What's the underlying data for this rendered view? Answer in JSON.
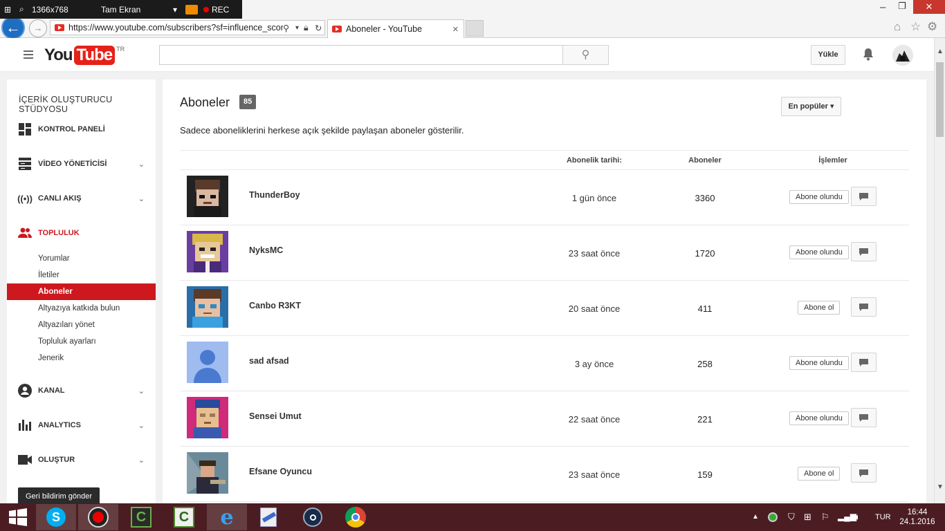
{
  "recorder": {
    "resolution": "1366x768",
    "mode": "Tam Ekran",
    "rec_label": "REC"
  },
  "browser": {
    "url": "https://www.youtube.com/subscribers?sf=influence_scor",
    "tab_title": "Aboneler - YouTube",
    "tab_close": "×"
  },
  "header": {
    "logo_you": "You",
    "logo_tube": "Tube",
    "logo_region": "TR",
    "search_placeholder": "",
    "upload_label": "Yükle"
  },
  "sidebar": {
    "studio_title": "İÇERİK OLUŞTURUCU STÜDYOSU",
    "sections": [
      {
        "label": "KONTROL PANELİ",
        "icon": "dashboard-icon",
        "expandable": false
      },
      {
        "label": "VİDEO YÖNETİCİSİ",
        "icon": "video-manager-icon",
        "expandable": true
      },
      {
        "label": "CANLI AKIŞ",
        "icon": "live-stream-icon",
        "expandable": true
      },
      {
        "label": "TOPLULUK",
        "icon": "community-icon",
        "expandable": false,
        "active": true
      },
      {
        "label": "KANAL",
        "icon": "channel-icon",
        "expandable": true
      },
      {
        "label": "ANALYTICS",
        "icon": "analytics-icon",
        "expandable": true
      },
      {
        "label": "OLUŞTUR",
        "icon": "create-icon",
        "expandable": true
      }
    ],
    "community_items": [
      "Yorumlar",
      "İletiler",
      "Aboneler",
      "Altyazıya katkıda bulun",
      "Altyazıları yönet",
      "Topluluk ayarları",
      "Jenerik"
    ],
    "feedback_label": "Geri bildirim gönder"
  },
  "main": {
    "title": "Aboneler",
    "count": "85",
    "sort_label": "En popüler",
    "description": "Sadece aboneliklerini herkese açık şekilde paylaşan aboneler gösterilir.",
    "columns": {
      "date": "Abonelik tarihi:",
      "subscribers": "Aboneler",
      "actions": "İşlemler"
    },
    "rows": [
      {
        "name": "ThunderBoy",
        "date": "1 gün önce",
        "subscribers": "3360",
        "action": "Abone olundu"
      },
      {
        "name": "NyksMC",
        "date": "23 saat önce",
        "subscribers": "1720",
        "action": "Abone olundu"
      },
      {
        "name": "Canbo R3KT",
        "date": "20 saat önce",
        "subscribers": "411",
        "action": "Abone ol"
      },
      {
        "name": "sad afsad",
        "date": "3 ay önce",
        "subscribers": "258",
        "action": "Abone olundu"
      },
      {
        "name": "Sensei Umut",
        "date": "22 saat önce",
        "subscribers": "221",
        "action": "Abone olundu"
      },
      {
        "name": "Efsane Oyuncu",
        "date": "23 saat önce",
        "subscribers": "159",
        "action": "Abone ol"
      }
    ]
  },
  "taskbar": {
    "language": "TUR",
    "time": "16:44",
    "date": "24.1.2016"
  },
  "colors": {
    "youtube_red": "#cc181e",
    "taskbar": "#4b1d22",
    "ie_blue": "#1e6ec2"
  }
}
